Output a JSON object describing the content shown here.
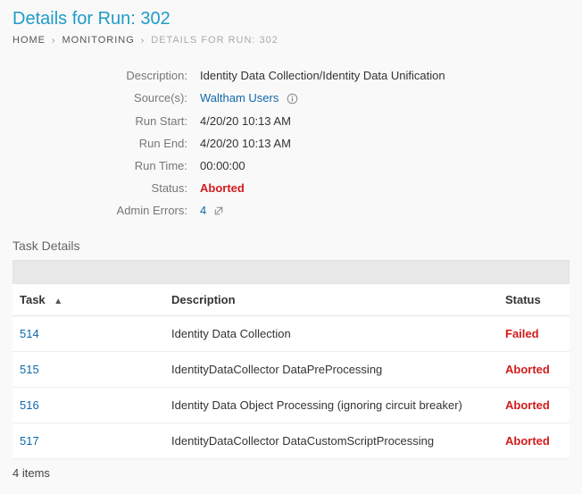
{
  "page_title": "Details for Run: 302",
  "breadcrumb": {
    "home": "HOME",
    "monitoring": "MONITORING",
    "current": "DETAILS FOR RUN: 302"
  },
  "details": {
    "description_label": "Description:",
    "description_value": "Identity Data Collection/Identity Data Unification",
    "sources_label": "Source(s):",
    "sources_value": "Waltham Users",
    "run_start_label": "Run Start:",
    "run_start_value": "4/20/20 10:13 AM",
    "run_end_label": "Run End:",
    "run_end_value": "4/20/20 10:13 AM",
    "run_time_label": "Run Time:",
    "run_time_value": "00:00:00",
    "status_label": "Status:",
    "status_value": "Aborted",
    "admin_errors_label": "Admin Errors:",
    "admin_errors_value": "4"
  },
  "task_section_title": "Task Details",
  "table": {
    "headers": {
      "task": "Task",
      "description": "Description",
      "status": "Status"
    },
    "rows": [
      {
        "id": "514",
        "desc": "Identity Data Collection",
        "status": "Failed",
        "status_class": "status-failed"
      },
      {
        "id": "515",
        "desc": "IdentityDataCollector DataPreProcessing",
        "status": "Aborted",
        "status_class": "status-aborted"
      },
      {
        "id": "516",
        "desc": "Identity Data Object Processing (ignoring circuit breaker)",
        "status": "Aborted",
        "status_class": "status-aborted"
      },
      {
        "id": "517",
        "desc": "IdentityDataCollector DataCustomScriptProcessing",
        "status": "Aborted",
        "status_class": "status-aborted"
      }
    ],
    "count_text": "4 items"
  }
}
